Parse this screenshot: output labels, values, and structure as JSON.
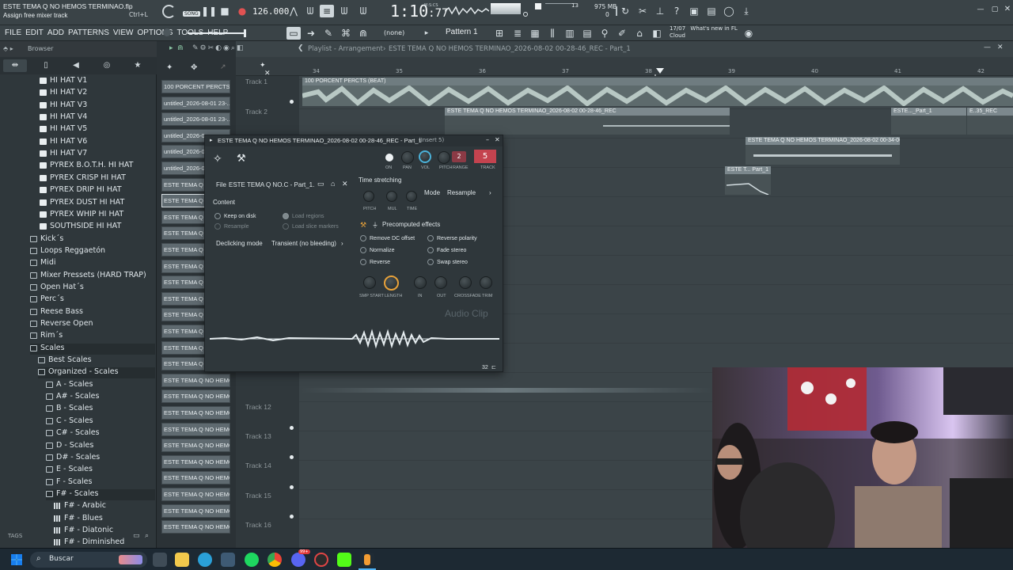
{
  "app": {
    "project_title": "ESTE TEMA Q NO HEMOS TERMINAO.flp",
    "hint": "Assign free mixer track",
    "shortcut": "Ctrl+L",
    "tempo": "126.000",
    "time": "1:10",
    "time_sub": ":77",
    "time_unit": "M:S:CS",
    "cpu_mem": "975 MB",
    "cpu_num": "13",
    "poly": "0",
    "song_mode": "SONG"
  },
  "menu": [
    "FILE",
    "EDIT",
    "ADD",
    "PATTERNS",
    "VIEW",
    "OPTIONS",
    "TOOLS",
    "HELP"
  ],
  "toolbar": {
    "snap": "(none)",
    "pattern": "Pattern 1",
    "news_date": "17/07",
    "news_text": "What's new in FL Cloud"
  },
  "browser": {
    "title": "Browser",
    "tags_label": "TAGS",
    "items": [
      {
        "label": "HI HAT V1",
        "type": "file",
        "indent": 1
      },
      {
        "label": "HI HAT V2",
        "type": "file",
        "indent": 1
      },
      {
        "label": "HI HAT V3",
        "type": "file",
        "indent": 1
      },
      {
        "label": "HI HAT V4",
        "type": "file",
        "indent": 1
      },
      {
        "label": "HI HAT V5",
        "type": "file",
        "indent": 1
      },
      {
        "label": "HI HAT V6",
        "type": "file",
        "indent": 1
      },
      {
        "label": "HI HAT V7",
        "type": "file",
        "indent": 1
      },
      {
        "label": "PYREX B.O.T.H. HI HAT",
        "type": "file",
        "indent": 1
      },
      {
        "label": "PYREX CRISP HI HAT",
        "type": "file",
        "indent": 1
      },
      {
        "label": "PYREX DRIP HI HAT",
        "type": "file",
        "indent": 1
      },
      {
        "label": "PYREX DUST HI HAT",
        "type": "file",
        "indent": 1
      },
      {
        "label": "PYREX WHIP HI HAT",
        "type": "file",
        "indent": 1
      },
      {
        "label": "SOUTHSIDE HI HAT",
        "type": "file",
        "indent": 1
      },
      {
        "label": "Kick´s",
        "type": "folder",
        "indent": 0
      },
      {
        "label": "Loops Reggaetón",
        "type": "folder",
        "indent": 0
      },
      {
        "label": "Midi",
        "type": "folder",
        "indent": 0
      },
      {
        "label": "Mixer Pressets (HARD TRAP)",
        "type": "folder",
        "indent": 0
      },
      {
        "label": "Open Hat´s",
        "type": "folder",
        "indent": 0
      },
      {
        "label": "Perc´s",
        "type": "folder",
        "indent": 0
      },
      {
        "label": "Reese Bass",
        "type": "folder",
        "indent": 0
      },
      {
        "label": "Reverse Open",
        "type": "folder",
        "indent": 0
      },
      {
        "label": "Rim´s",
        "type": "folder",
        "indent": 0
      },
      {
        "label": "Scales",
        "type": "folder",
        "indent": 0
      },
      {
        "label": "Best Scales",
        "type": "folder",
        "indent": 1
      },
      {
        "label": "Organized - Scales",
        "type": "folder",
        "indent": 1
      },
      {
        "label": "A - Scales",
        "type": "folder",
        "indent": 2
      },
      {
        "label": "A# - Scales",
        "type": "folder",
        "indent": 2
      },
      {
        "label": "B - Scales",
        "type": "folder",
        "indent": 2
      },
      {
        "label": "C - Scales",
        "type": "folder",
        "indent": 2
      },
      {
        "label": "C# - Scales",
        "type": "folder",
        "indent": 2
      },
      {
        "label": "D - Scales",
        "type": "folder",
        "indent": 2
      },
      {
        "label": "D# - Scales",
        "type": "folder",
        "indent": 2
      },
      {
        "label": "E - Scales",
        "type": "folder",
        "indent": 2
      },
      {
        "label": "F - Scales",
        "type": "folder",
        "indent": 2
      },
      {
        "label": "F# - Scales",
        "type": "folder",
        "indent": 2
      },
      {
        "label": "F# - Arabic",
        "type": "grid",
        "indent": 3
      },
      {
        "label": "F# - Blues",
        "type": "grid",
        "indent": 3
      },
      {
        "label": "F# - Diatonic",
        "type": "grid",
        "indent": 3
      },
      {
        "label": "F# - Diminished",
        "type": "grid",
        "indent": 3
      }
    ]
  },
  "channels": [
    "100 PORCENT PERCTS...",
    "untitled_2026-08-01 23-...",
    "untitled_2026-08-01 23-...",
    "untitled_2026-0",
    "untitled_2026-0",
    "untitled_2026-0",
    "ESTE TEMA Q NO",
    "ESTE TEMA Q NO",
    "ESTE TEMA Q NO",
    "ESTE TEMA Q NO",
    "ESTE TEMA Q NO",
    "ESTE TEMA Q NO",
    "ESTE TEMA Q NO",
    "ESTE TEMA Q NO",
    "ESTE TEMA Q NO",
    "ESTE TEMA Q NO",
    "ESTE TEMA Q NO",
    "ESTE TEMA Q NO HEMOS T...",
    "ESTE TEMA Q NO HEMOS T...",
    "ESTE TEMA Q NO HEMOS T...",
    "ESTE TEMA Q NO HEMOS T...",
    "ESTE TEMA Q NO HEMOS T...",
    "ESTE TEMA Q NO HEMOS T...",
    "ESTE TEMA Q NO HEMOS T...",
    "ESTE TEMA Q NO HEMOS T...",
    "ESTE TEMA Q NO HEMOS T...",
    "ESTE TEMA Q NO HEMOS T...",
    "ESTE TEMA Q NO HEMOS T..."
  ],
  "playlist": {
    "title": "Playlist - Arrangement",
    "breadcrumb": "ESTE TEMA Q NO HEMOS TERMINAO_2026-08-02 00-28-46_REC - Part_1",
    "bars": [
      "34",
      "35",
      "36",
      "37",
      "38",
      "39",
      "40",
      "41",
      "42"
    ],
    "tracks": [
      {
        "label": "Track 1"
      },
      {
        "label": "Track 2"
      },
      {
        "label": "Track 12"
      },
      {
        "label": "Track 13"
      },
      {
        "label": "Track 14"
      },
      {
        "label": "Track 15"
      },
      {
        "label": "Track 16"
      }
    ],
    "clips": [
      {
        "label": "100 PORCENT PERCTS (BEAT)"
      },
      {
        "label": "ESTE TEMA Q NO HEMOS TERMINAO_2026-08-02 00-28-46_REC"
      },
      {
        "label": "ESTE..._Part_1"
      },
      {
        "label": "E..35_REC"
      },
      {
        "label": "ESTE TEMA Q NO HEMOS TERMINAO_2026-08-02 00-34-06_REC"
      },
      {
        "label": "ESTE T... Part_1"
      }
    ]
  },
  "plugin": {
    "title": "ESTE TEMA Q NO HEMOS TERMINAO_2026-08-02 00-28-46_REC - Part_1",
    "insert": "(Insert 5)",
    "knob_labels": [
      "ON",
      "PAN",
      "VOL",
      "PITCH",
      "RANGE",
      "TRACK"
    ],
    "range_value": "2",
    "track_value": "5",
    "file_label": "File",
    "file_name": "ESTE TEMA Q NO.C - Part_1.wav",
    "content_label": "Content",
    "keep_on_disk": "Keep on disk",
    "load_regions": "Load regions",
    "resample": "Resample",
    "load_slice_markers": "Load slice markers",
    "declicking_label": "Declicking mode",
    "declicking_value": "Transient (no bleeding)",
    "time_stretching": "Time stretching",
    "ts_knobs": [
      "PITCH",
      "MUL",
      "TIME"
    ],
    "mode_label": "Mode",
    "mode_value": "Resample",
    "precomputed": "Precomputed effects",
    "effects_left": [
      "Remove DC offset",
      "Normalize",
      "Reverse"
    ],
    "effects_right": [
      "Reverse polarity",
      "Fade stereo",
      "Swap stereo"
    ],
    "env_knobs": [
      "SMP START",
      "LENGTH",
      "IN",
      "OUT",
      "CROSSFADE",
      "TRIM"
    ],
    "watermark": "Audio Clip",
    "footer_value": "32"
  },
  "taskbar": {
    "search_placeholder": "Buscar",
    "badge": "99+"
  },
  "colors": {
    "accent_orange": "#e8a23a",
    "accent_red": "#c4434f",
    "clip_teal": "#c8d8d3"
  }
}
